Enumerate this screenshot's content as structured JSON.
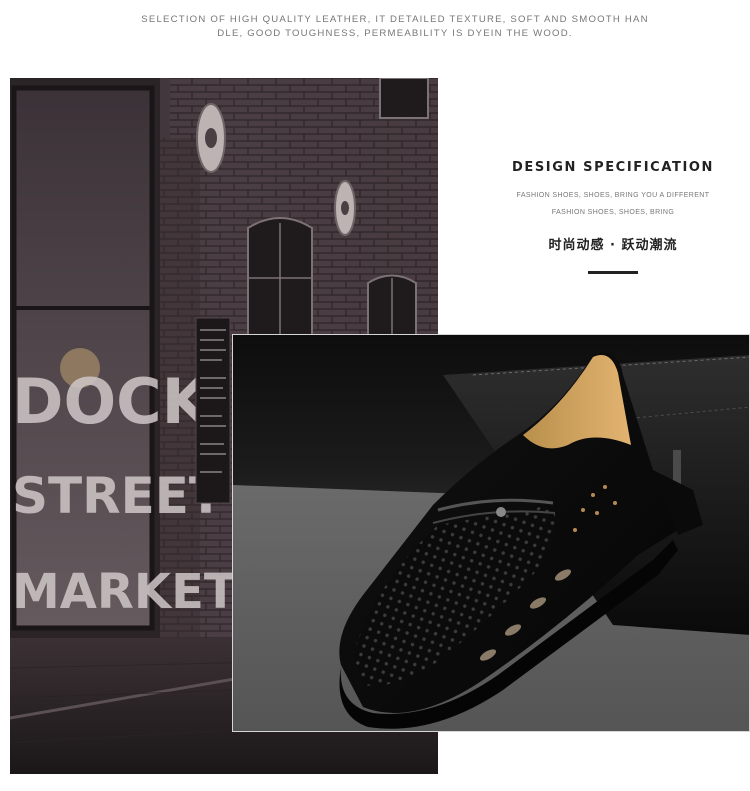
{
  "top_caption": {
    "line1": "SELECTION OF HIGH QUALITY LEATHER, IT DETAILED TEXTURE, SOFT AND SMOOTH HAN",
    "line2": "DLE, GOOD TOUGHNESS, PERMEABILITY IS DYEIN THE WOOD."
  },
  "spec": {
    "title": "DESIGN SPECIFICATION",
    "sub_line1": "FASHION SHOES, SHOES, BRING YOU A DIFFERENT",
    "sub_line2": "FASHION SHOES, SHOES, BRING",
    "chinese_tagline": "时尚动感 · 跃动潮流"
  },
  "street_photo": {
    "sign_lines": [
      "DOCK",
      "STREET",
      "MARKET"
    ]
  },
  "colors": {
    "accent": "#222222",
    "caption_gray": "#777777"
  }
}
